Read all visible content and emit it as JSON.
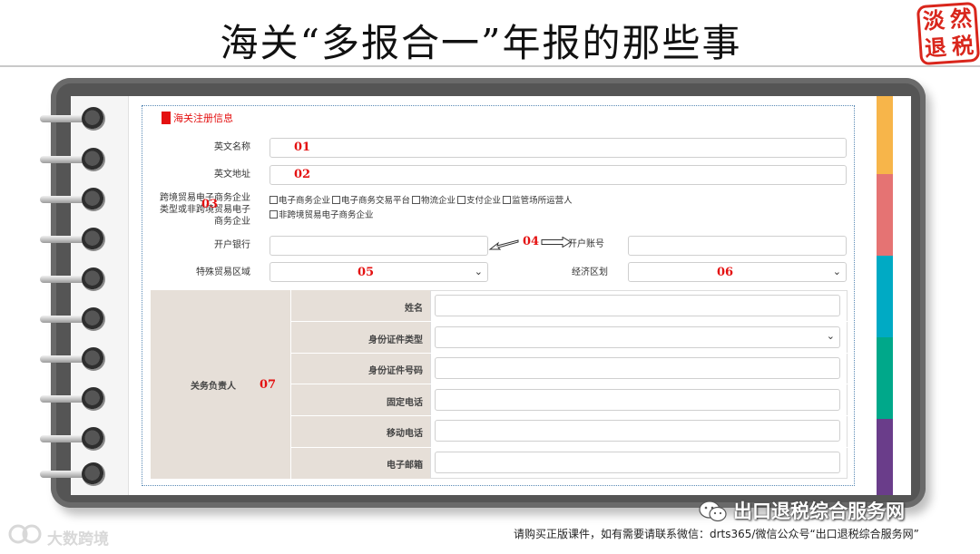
{
  "slide": {
    "title": "海关“多报合一”年报的那些事",
    "seal_chars": [
      "淡",
      "然",
      "退",
      "税"
    ]
  },
  "form": {
    "section_title": "海关注册信息",
    "english_name": {
      "label": "英文名称",
      "annotation": "01"
    },
    "english_address": {
      "label": "英文地址",
      "annotation": "02"
    },
    "enterprise_type": {
      "label_lines": [
        "跨境贸易电子商务企业",
        "类型或非跨境贸易电子",
        "商务企业"
      ],
      "annotation": "03",
      "options_row1": [
        "电子商务企业",
        "电子商务交易平台",
        "物流企业",
        "支付企业",
        "监管场所运营人"
      ],
      "options_row2": [
        "非跨境贸易电子商务企业"
      ]
    },
    "bank": {
      "label": "开户银行",
      "annotation": "04",
      "account_label": "开户账号"
    },
    "special_zone": {
      "label": "特殊贸易区域",
      "annotation": "05"
    },
    "economic_zone": {
      "label": "经济区划",
      "annotation": "06"
    },
    "contact": {
      "label": "关务负责人",
      "annotation": "07",
      "rows": [
        {
          "label": "姓名",
          "type": "input"
        },
        {
          "label": "身份证件类型",
          "type": "select"
        },
        {
          "label": "身份证件号码",
          "type": "input"
        },
        {
          "label": "固定电话",
          "type": "input"
        },
        {
          "label": "移动电话",
          "type": "input"
        },
        {
          "label": "电子邮箱",
          "type": "input"
        }
      ]
    }
  },
  "tabs_colors": [
    "#f7b54a",
    "#e57373",
    "#00aac4",
    "#00a88a",
    "#6a3d8a"
  ],
  "footer": {
    "brand": "出口退税综合服务网",
    "note": "请购买正版课件，如有需要请联系微信：drts365/微信公众号“出口退税综合服务网”",
    "watermark": "大数跨境"
  }
}
